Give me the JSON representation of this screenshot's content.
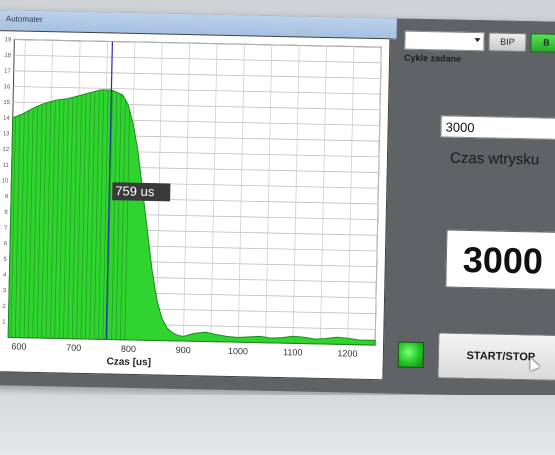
{
  "window": {
    "title": "Automater"
  },
  "plot": {
    "cursor_label": "759 us",
    "chart_data": {
      "type": "area",
      "xlabel": "Czas [us]",
      "ylabel": "",
      "title": "",
      "xlim": [
        580,
        1250
      ],
      "ylim": [
        0,
        19
      ],
      "x_ticks": [
        600,
        700,
        800,
        900,
        1000,
        1100,
        1200
      ],
      "y_ticks": [
        1,
        2,
        3,
        4,
        5,
        6,
        7,
        8,
        9,
        10,
        11,
        12,
        13,
        14,
        15,
        16,
        17,
        18,
        19
      ],
      "grid": true,
      "fill_color": "#2fd42f",
      "cursor_x": 759,
      "series": [
        {
          "x": [
            580,
            600,
            620,
            640,
            660,
            680,
            700,
            720,
            740,
            760,
            780,
            790,
            800,
            810,
            820,
            830,
            840,
            850,
            860,
            870,
            880,
            890,
            900,
            920,
            940,
            960,
            980,
            1000,
            1020,
            1040,
            1060,
            1080,
            1100,
            1120,
            1140,
            1160,
            1180,
            1200,
            1220,
            1250
          ],
          "y": [
            14.0,
            14.3,
            14.7,
            15.0,
            15.2,
            15.3,
            15.5,
            15.7,
            15.9,
            15.9,
            15.6,
            15.0,
            13.8,
            12.0,
            9.5,
            7.0,
            4.5,
            2.6,
            1.4,
            0.8,
            0.5,
            0.35,
            0.3,
            0.5,
            0.6,
            0.45,
            0.35,
            0.3,
            0.35,
            0.4,
            0.3,
            0.35,
            0.45,
            0.4,
            0.3,
            0.35,
            0.45,
            0.4,
            0.3,
            0.3
          ]
        }
      ]
    }
  },
  "controls": {
    "combo_value": "",
    "bip_label": "BIP",
    "green_label": "B",
    "cycles_label": "Cykle zadane",
    "injection_value": "3000",
    "injection_label": "Czas wtrysku",
    "big_display_value": "3000",
    "start_stop_label": "START/STOP",
    "led_color": "#22c422"
  }
}
